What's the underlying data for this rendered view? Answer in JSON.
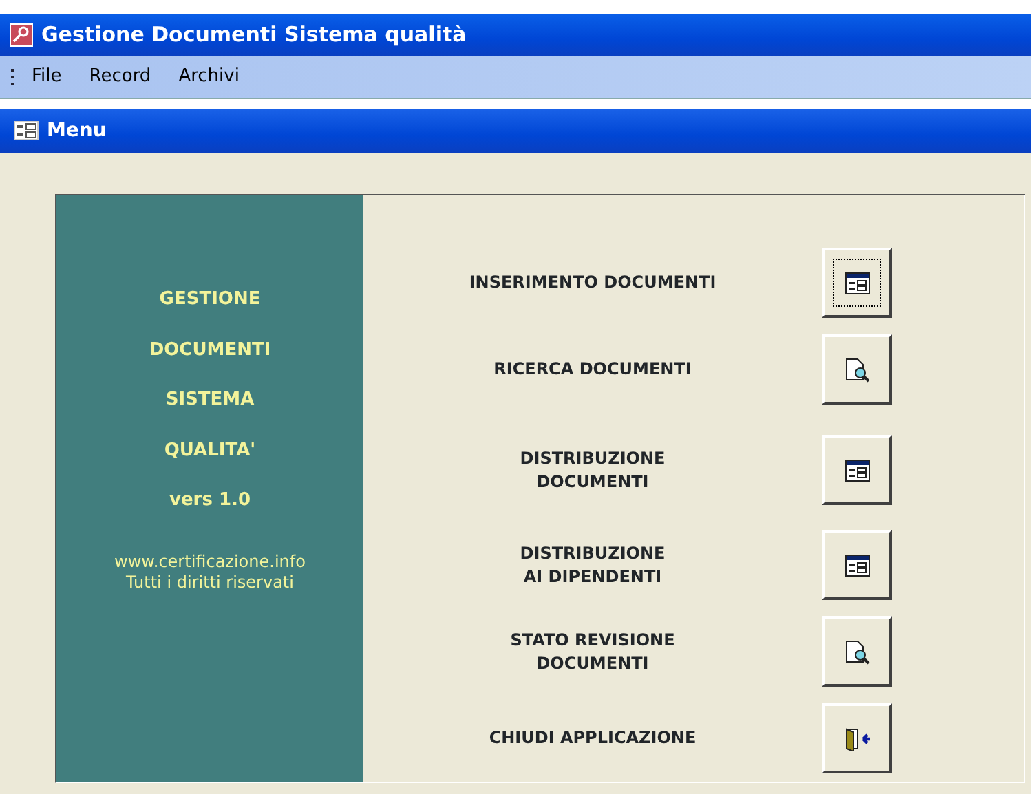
{
  "window": {
    "title": "Gestione Documenti Sistema qualità"
  },
  "menu_bar": [
    "File",
    "Record",
    "Archivi"
  ],
  "form": {
    "title": "Menu"
  },
  "side_panel": {
    "lines": [
      "GESTIONE",
      "DOCUMENTI",
      "SISTEMA",
      "QUALITA'",
      "vers 1.0"
    ],
    "footer": [
      "www.certificazione.info",
      "Tutti i diritti riservati"
    ]
  },
  "items": [
    {
      "label": "INSERIMENTO DOCUMENTI",
      "kind": "form",
      "focused": true
    },
    {
      "label": "RICERCA DOCUMENTI",
      "kind": "search",
      "focused": false
    },
    {
      "label": "DISTRIBUZIONE\nDOCUMENTI",
      "kind": "form",
      "focused": false
    },
    {
      "label": "DISTRIBUZIONE\nAI DIPENDENTI",
      "kind": "form",
      "focused": false
    },
    {
      "label": "STATO REVISIONE\nDOCUMENTI",
      "kind": "search",
      "focused": false
    },
    {
      "label": "CHIUDI APPLICAZIONE",
      "kind": "exit",
      "focused": false
    }
  ]
}
